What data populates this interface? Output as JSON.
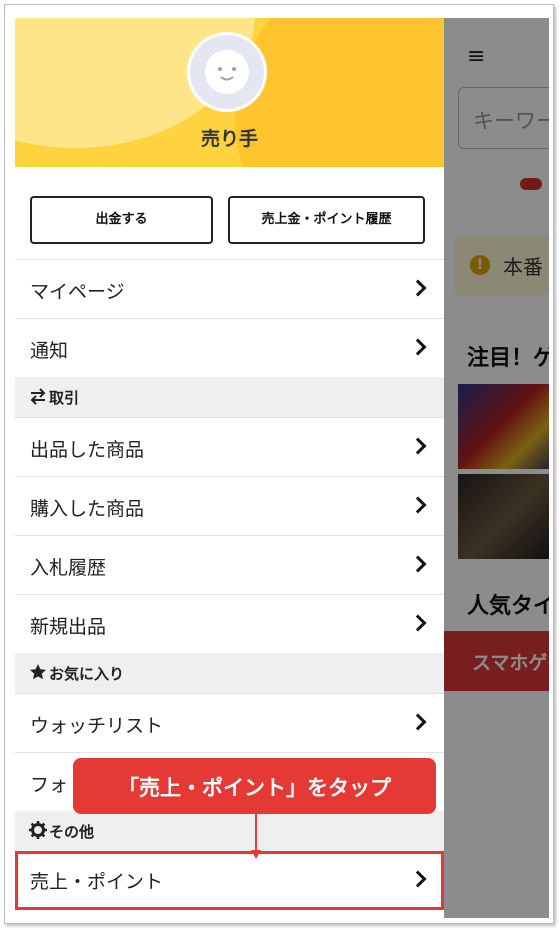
{
  "background": {
    "search_placeholder": "キーワー",
    "notice_text": "本番",
    "section_featured": "注目！ゲ",
    "section_popular": "人気タイ",
    "red_button": "スマホゲ"
  },
  "drawer": {
    "username": "売り手",
    "buttons": {
      "withdraw": "出金する",
      "history": "売上金・ポイント履歴"
    },
    "items": {
      "mypage": "マイページ",
      "notifications": "通知",
      "section_trade": "取引",
      "listed": "出品した商品",
      "purchased": "購入した商品",
      "bids": "入札履歴",
      "new_listing": "新規出品",
      "section_favorites": "お気に入り",
      "watchlist": "ウォッチリスト",
      "follow": "フォ",
      "section_other": "その他",
      "sales_points": "売上・ポイント"
    }
  },
  "callout": {
    "text": "「売上・ポイント」をタップ"
  },
  "colors": {
    "accent_red": "#e53935",
    "header_yellow": "#ffd33f"
  }
}
